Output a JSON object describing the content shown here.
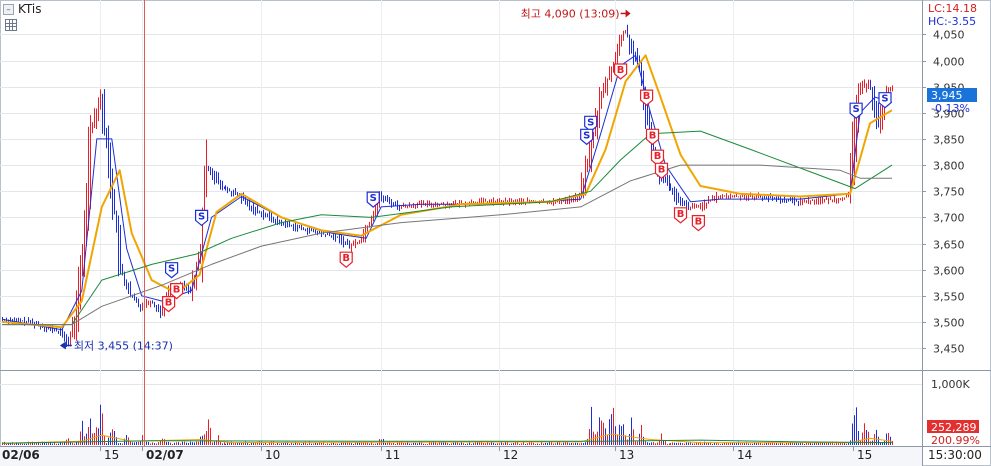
{
  "title": "KTis",
  "indicators": {
    "lc": "LC:14.18",
    "hc": "HC:-3.55"
  },
  "current": {
    "price": "3,945",
    "change": "-0.13%"
  },
  "volume_panel": {
    "max_label": "1,000K",
    "current": "252,289",
    "ratio": "200.99%"
  },
  "annotations": {
    "high": {
      "label": "최고 4,090 (13:09)",
      "value": 4090
    },
    "low": {
      "label": "최저 3,455 (14:37)",
      "value": 3455
    }
  },
  "colors": {
    "up": "#e8202a",
    "down": "#1d2fd6",
    "ma5": "#1d2fd6",
    "ma20": "#f0a500",
    "ma60": "#1a8a3a",
    "ma120": "#777777",
    "price_tag": "#1a73d8",
    "vol_tag": "#e23030"
  },
  "chart_data": {
    "type": "candlestick",
    "price_axis": {
      "ylim": [
        3410,
        4110
      ],
      "ticks": [
        3450,
        3500,
        3550,
        3600,
        3650,
        3700,
        3750,
        3800,
        3850,
        3900,
        3950,
        4000,
        4050
      ],
      "tick_labels": [
        "3,450",
        "3,500",
        "3,550",
        "3,600",
        "3,650",
        "3,700",
        "3,750",
        "3,800",
        "3,850",
        "3,900",
        "3,950",
        "4,000",
        "4,050"
      ]
    },
    "x_axis": {
      "labels": [
        "02/06",
        "15",
        "02/07",
        "10",
        "11",
        "12",
        "13",
        "14",
        "15",
        "15:30:00"
      ]
    },
    "price": [
      [
        0,
        3505
      ],
      [
        30,
        3500
      ],
      [
        60,
        3480
      ],
      [
        68,
        3460
      ],
      [
        75,
        3510
      ],
      [
        82,
        3620
      ],
      [
        90,
        3870
      ],
      [
        100,
        3930
      ],
      [
        110,
        3780
      ],
      [
        120,
        3600
      ],
      [
        130,
        3550
      ],
      [
        140,
        3530
      ],
      [
        150,
        3540
      ],
      [
        160,
        3520
      ],
      [
        170,
        3560
      ],
      [
        180,
        3570
      ],
      [
        190,
        3560
      ],
      [
        200,
        3630
      ],
      [
        205,
        3800
      ],
      [
        210,
        3790
      ],
      [
        220,
        3760
      ],
      [
        230,
        3750
      ],
      [
        240,
        3740
      ],
      [
        250,
        3720
      ],
      [
        260,
        3710
      ],
      [
        280,
        3690
      ],
      [
        300,
        3680
      ],
      [
        320,
        3670
      ],
      [
        340,
        3660
      ],
      [
        350,
        3645
      ],
      [
        360,
        3655
      ],
      [
        370,
        3690
      ],
      [
        380,
        3740
      ],
      [
        390,
        3730
      ],
      [
        400,
        3720
      ],
      [
        420,
        3725
      ],
      [
        450,
        3725
      ],
      [
        480,
        3730
      ],
      [
        520,
        3730
      ],
      [
        560,
        3730
      ],
      [
        580,
        3740
      ],
      [
        590,
        3820
      ],
      [
        600,
        3920
      ],
      [
        615,
        4000
      ],
      [
        625,
        4060
      ],
      [
        640,
        3980
      ],
      [
        650,
        3860
      ],
      [
        660,
        3790
      ],
      [
        670,
        3760
      ],
      [
        680,
        3730
      ],
      [
        690,
        3720
      ],
      [
        700,
        3720
      ],
      [
        720,
        3740
      ],
      [
        760,
        3740
      ],
      [
        800,
        3730
      ],
      [
        840,
        3735
      ],
      [
        850,
        3740
      ],
      [
        860,
        3940
      ],
      [
        870,
        3960
      ],
      [
        880,
        3880
      ],
      [
        890,
        3945
      ]
    ],
    "moving_averages": [
      {
        "period": 5,
        "points": [
          [
            0,
            3505
          ],
          [
            60,
            3485
          ],
          [
            80,
            3560
          ],
          [
            95,
            3850
          ],
          [
            110,
            3850
          ],
          [
            125,
            3640
          ],
          [
            140,
            3550
          ],
          [
            160,
            3540
          ],
          [
            190,
            3560
          ],
          [
            210,
            3700
          ],
          [
            240,
            3740
          ],
          [
            280,
            3700
          ],
          [
            330,
            3670
          ],
          [
            365,
            3660
          ],
          [
            380,
            3720
          ],
          [
            420,
            3725
          ],
          [
            500,
            3725
          ],
          [
            580,
            3735
          ],
          [
            600,
            3860
          ],
          [
            620,
            3990
          ],
          [
            635,
            4010
          ],
          [
            650,
            3900
          ],
          [
            665,
            3800
          ],
          [
            690,
            3730
          ],
          [
            720,
            3735
          ],
          [
            800,
            3735
          ],
          [
            850,
            3745
          ],
          [
            860,
            3900
          ],
          [
            875,
            3930
          ],
          [
            892,
            3920
          ]
        ]
      },
      {
        "period": 20,
        "points": [
          [
            0,
            3500
          ],
          [
            60,
            3490
          ],
          [
            80,
            3540
          ],
          [
            100,
            3720
          ],
          [
            118,
            3790
          ],
          [
            130,
            3670
          ],
          [
            150,
            3580
          ],
          [
            175,
            3555
          ],
          [
            198,
            3590
          ],
          [
            215,
            3710
          ],
          [
            240,
            3745
          ],
          [
            280,
            3700
          ],
          [
            320,
            3675
          ],
          [
            360,
            3665
          ],
          [
            400,
            3705
          ],
          [
            460,
            3725
          ],
          [
            550,
            3730
          ],
          [
            585,
            3745
          ],
          [
            605,
            3830
          ],
          [
            625,
            3960
          ],
          [
            645,
            4010
          ],
          [
            660,
            3930
          ],
          [
            680,
            3820
          ],
          [
            700,
            3760
          ],
          [
            740,
            3745
          ],
          [
            800,
            3740
          ],
          [
            850,
            3745
          ],
          [
            870,
            3880
          ],
          [
            892,
            3905
          ]
        ]
      },
      {
        "period": 60,
        "points": [
          [
            0,
            3495
          ],
          [
            40,
            3495
          ],
          [
            70,
            3495
          ],
          [
            100,
            3580
          ],
          [
            150,
            3610
          ],
          [
            195,
            3630
          ],
          [
            230,
            3660
          ],
          [
            280,
            3690
          ],
          [
            320,
            3705
          ],
          [
            370,
            3700
          ],
          [
            450,
            3720
          ],
          [
            550,
            3730
          ],
          [
            590,
            3750
          ],
          [
            620,
            3810
          ],
          [
            650,
            3860
          ],
          [
            700,
            3865
          ],
          [
            750,
            3830
          ],
          [
            820,
            3780
          ],
          [
            855,
            3755
          ],
          [
            892,
            3800
          ]
        ]
      },
      {
        "period": 120,
        "points": [
          [
            0,
            3495
          ],
          [
            70,
            3495
          ],
          [
            100,
            3530
          ],
          [
            160,
            3570
          ],
          [
            210,
            3610
          ],
          [
            260,
            3645
          ],
          [
            320,
            3670
          ],
          [
            400,
            3690
          ],
          [
            500,
            3705
          ],
          [
            580,
            3720
          ],
          [
            630,
            3770
          ],
          [
            680,
            3800
          ],
          [
            760,
            3800
          ],
          [
            840,
            3790
          ],
          [
            860,
            3775
          ],
          [
            892,
            3775
          ]
        ]
      }
    ],
    "volume": {
      "ylim": [
        0,
        1000000
      ],
      "bursts": [
        [
          65,
          150000
        ],
        [
          80,
          500000
        ],
        [
          88,
          700000
        ],
        [
          98,
          900000
        ],
        [
          110,
          500000
        ],
        [
          125,
          250000
        ],
        [
          140,
          180000
        ],
        [
          160,
          150000
        ],
        [
          200,
          300000
        ],
        [
          205,
          600000
        ],
        [
          215,
          200000
        ],
        [
          380,
          150000
        ],
        [
          590,
          700000
        ],
        [
          600,
          850000
        ],
        [
          610,
          980000
        ],
        [
          620,
          650000
        ],
        [
          630,
          450000
        ],
        [
          640,
          350000
        ],
        [
          660,
          250000
        ],
        [
          855,
          750000
        ],
        [
          865,
          500000
        ],
        [
          875,
          350000
        ],
        [
          888,
          300000
        ]
      ],
      "baseline": 40000
    },
    "signals": [
      {
        "type": "S",
        "t": 170,
        "price": 3600
      },
      {
        "type": "B",
        "t": 175,
        "price": 3560
      },
      {
        "type": "B",
        "t": 167,
        "price": 3535
      },
      {
        "type": "S",
        "t": 200,
        "price": 3700
      },
      {
        "type": "B",
        "t": 345,
        "price": 3620
      },
      {
        "type": "S",
        "t": 372,
        "price": 3735
      },
      {
        "type": "S",
        "t": 590,
        "price": 3880
      },
      {
        "type": "S",
        "t": 586,
        "price": 3855
      },
      {
        "type": "B",
        "t": 620,
        "price": 3980
      },
      {
        "type": "B",
        "t": 646,
        "price": 3930
      },
      {
        "type": "B",
        "t": 652,
        "price": 3855
      },
      {
        "type": "B",
        "t": 657,
        "price": 3815
      },
      {
        "type": "B",
        "t": 661,
        "price": 3790
      },
      {
        "type": "B",
        "t": 680,
        "price": 3705
      },
      {
        "type": "B",
        "t": 698,
        "price": 3690
      },
      {
        "type": "S",
        "t": 856,
        "price": 3905
      },
      {
        "type": "S",
        "t": 885,
        "price": 3925
      }
    ]
  }
}
